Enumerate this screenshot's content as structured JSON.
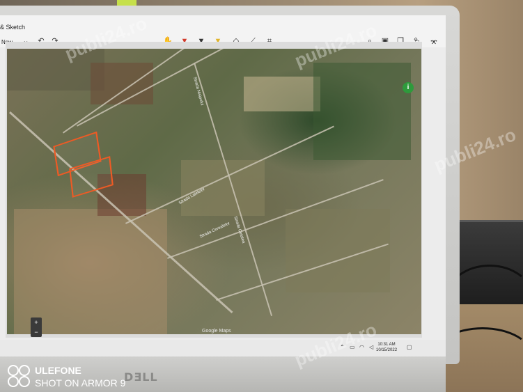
{
  "app": {
    "title": "& Sketch",
    "new_label": "New"
  },
  "toolbar": {
    "icons": [
      "touch-write-icon",
      "ballpoint-pen-icon",
      "pencil-icon",
      "highlighter-icon",
      "eraser-icon",
      "ruler-icon",
      "crop-icon"
    ],
    "right_icons": [
      "zoom-icon",
      "save-icon",
      "copy-icon",
      "share-icon",
      "more-icon"
    ]
  },
  "map": {
    "streets": [
      "Strada Nisipului",
      "Strada Lalelelor",
      "Strada Cerealelor",
      "Strada Cetatea"
    ],
    "footer": "Google Maps",
    "zoom_in": "+",
    "zoom_out": "−"
  },
  "taskbar": {
    "time": "10:31 AM",
    "date": "10/15/2022"
  },
  "laptop": {
    "brand": "DƎLL"
  },
  "phone": {
    "line1": "ULEFONE",
    "line2": "SHOT ON ARMOR 9"
  },
  "watermark": "publi24.ro",
  "colors": {
    "parcel": "#f05a24",
    "accent": "#2b6fd6"
  }
}
